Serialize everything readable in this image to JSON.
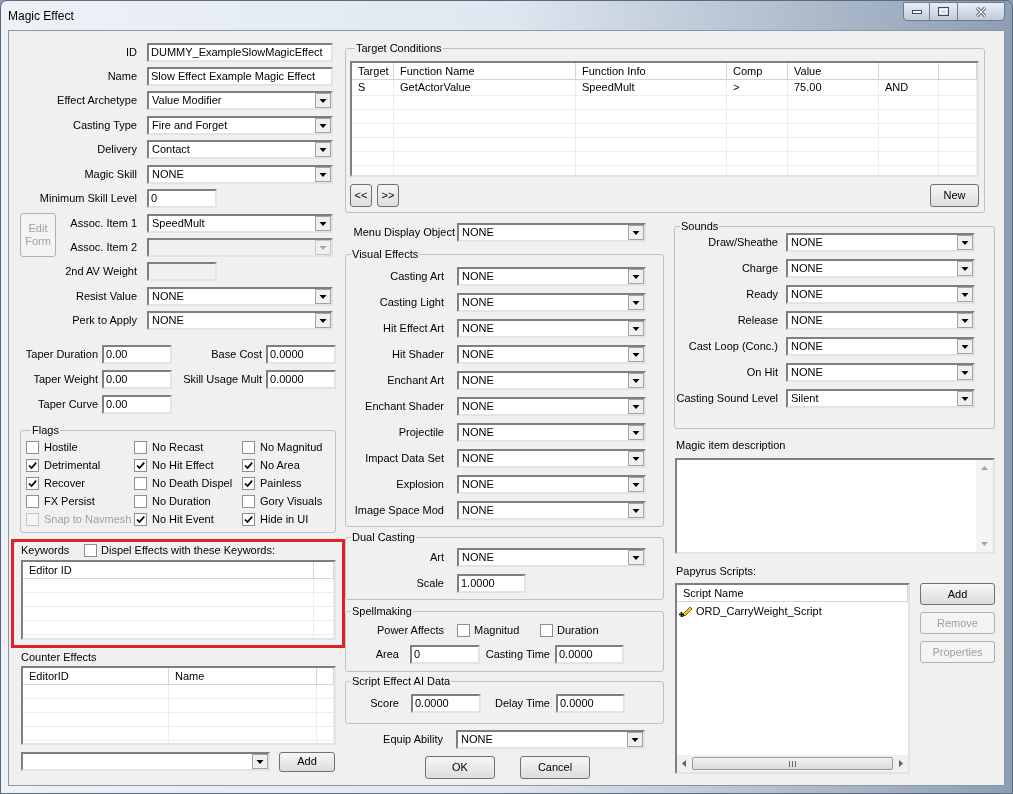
{
  "window": {
    "title": "Magic Effect"
  },
  "general": {
    "fields": [
      {
        "kind": "text",
        "label": "ID",
        "value": "DUMMY_ExampleSlowMagicEffect",
        "disabled": false
      },
      {
        "kind": "text",
        "label": "Name",
        "value": "Slow Effect Example Magic Effect",
        "disabled": false
      },
      {
        "kind": "dropdown",
        "label": "Effect Archetype",
        "value": "Value Modifier",
        "disabled": false
      },
      {
        "kind": "dropdown",
        "label": "Casting Type",
        "value": "Fire and Forget",
        "disabled": false
      },
      {
        "kind": "dropdown",
        "label": "Delivery",
        "value": "Contact",
        "disabled": false
      },
      {
        "kind": "dropdown",
        "label": "Magic Skill",
        "value": "NONE",
        "disabled": false
      },
      {
        "kind": "number",
        "label": "Minimum Skill Level",
        "value": "0",
        "disabled": false
      },
      {
        "kind": "button_group",
        "button": {
          "label": "Edit Form",
          "disabled": true
        },
        "fields": [
          {
            "kind": "dropdown",
            "label": "Assoc. Item 1",
            "value": "SpeedMult",
            "disabled": false
          },
          {
            "kind": "dropdown",
            "label": "Assoc. Item 2",
            "disabled": true
          }
        ]
      },
      {
        "kind": "number",
        "label": "2nd AV Weight",
        "disabled": true
      },
      {
        "kind": "dropdown",
        "label": "Resist Value",
        "value": "NONE",
        "disabled": false
      },
      {
        "kind": "dropdown",
        "label": "Perk to Apply",
        "value": "NONE",
        "disabled": false
      }
    ]
  },
  "taper": [
    {
      "label": "Taper Duration",
      "value": "0.00"
    },
    {
      "label": "Taper Weight",
      "value": "0.00"
    },
    {
      "label": "Taper Curve",
      "value": "0.00"
    }
  ],
  "costs": [
    {
      "label": "Base Cost",
      "value": "0.0000"
    },
    {
      "label": "Skill Usage Mult",
      "value": "0.0000"
    }
  ],
  "flags": {
    "title": "Flags",
    "items": [
      {
        "label": "Hostile",
        "checked": false,
        "disabled": false
      },
      {
        "label": "No Recast",
        "checked": false,
        "disabled": false
      },
      {
        "label": "No Magnitud",
        "checked": false,
        "disabled": false
      },
      {
        "label": "Detrimental",
        "checked": true,
        "disabled": false
      },
      {
        "label": "No Hit Effect",
        "checked": true,
        "disabled": false
      },
      {
        "label": "No Area",
        "checked": true,
        "disabled": false
      },
      {
        "label": "Recover",
        "checked": true,
        "disabled": false
      },
      {
        "label": "No Death Dispel",
        "checked": false,
        "disabled": false
      },
      {
        "label": "Painless",
        "checked": true,
        "disabled": false
      },
      {
        "label": "FX Persist",
        "checked": false,
        "disabled": false
      },
      {
        "label": "No Duration",
        "checked": false,
        "disabled": false
      },
      {
        "label": "Gory Visuals",
        "checked": false,
        "disabled": false
      },
      {
        "label": "Snap to Navmesh",
        "checked": false,
        "disabled": true
      },
      {
        "label": "No Hit Event",
        "checked": true,
        "disabled": false
      },
      {
        "label": "Hide in UI",
        "checked": true,
        "disabled": false
      }
    ]
  },
  "keywords": {
    "title": "Keywords",
    "highlighted": true,
    "dispel": {
      "label": "Dispel Effects with these Keywords:",
      "checked": false
    },
    "columns": [
      "Editor ID"
    ]
  },
  "counter_effects": {
    "title": "Counter Effects",
    "columns": [
      "EditorID",
      "Name"
    ],
    "add_button": "Add"
  },
  "target_conditions": {
    "title": "Target Conditions",
    "columns": [
      "Target",
      "Function Name",
      "Function Info",
      "Comp",
      "Value"
    ],
    "rows": [
      [
        "S",
        "GetActorValue",
        "SpeedMult",
        ">",
        "75.00",
        "AND"
      ]
    ],
    "nav_buttons": [
      "<<",
      ">>"
    ],
    "new_button": "New"
  },
  "menu_display_object": {
    "label": "Menu Display Object",
    "value": "NONE"
  },
  "visual_effects": {
    "title": "Visual Effects",
    "items": [
      {
        "label": "Casting Art",
        "value": "NONE"
      },
      {
        "label": "Casting Light",
        "value": "NONE"
      },
      {
        "label": "Hit Effect Art",
        "value": "NONE"
      },
      {
        "label": "Hit Shader",
        "value": "NONE"
      },
      {
        "label": "Enchant Art",
        "value": "NONE"
      },
      {
        "label": "Enchant Shader",
        "value": "NONE"
      },
      {
        "label": "Projectile",
        "value": "NONE"
      },
      {
        "label": "Impact Data Set",
        "value": "NONE"
      },
      {
        "label": "Explosion",
        "value": "NONE"
      },
      {
        "label": "Image Space Mod",
        "value": "NONE"
      }
    ]
  },
  "dual_casting": {
    "title": "Dual Casting",
    "art": {
      "label": "Art",
      "value": "NONE"
    },
    "scale": {
      "label": "Scale",
      "value": "1.0000"
    }
  },
  "spellmaking": {
    "title": "Spellmaking",
    "power_affects": {
      "label": "Power Affects",
      "options": [
        {
          "label": "Magnitud",
          "checked": false
        },
        {
          "label": "Duration",
          "checked": false
        }
      ]
    },
    "area": {
      "label": "Area",
      "value": "0"
    },
    "casting_time": {
      "label": "Casting Time",
      "value": "0.0000"
    }
  },
  "script_effect_ai": {
    "title": "Script Effect AI Data",
    "score": {
      "label": "Score",
      "value": "0.0000"
    },
    "delay_time": {
      "label": "Delay Time",
      "value": "0.0000"
    }
  },
  "equip_ability": {
    "label": "Equip Ability",
    "value": "NONE"
  },
  "dialog_buttons": [
    "OK",
    "Cancel"
  ],
  "sounds": {
    "title": "Sounds",
    "items": [
      {
        "label": "Draw/Sheathe",
        "value": "NONE"
      },
      {
        "label": "Charge",
        "value": "NONE"
      },
      {
        "label": "Ready",
        "value": "NONE"
      },
      {
        "label": "Release",
        "value": "NONE"
      },
      {
        "label": "Cast Loop (Conc.)",
        "value": "NONE"
      },
      {
        "label": "On Hit",
        "value": "NONE"
      },
      {
        "label": "Casting Sound Level",
        "value": "Silent"
      }
    ]
  },
  "description": {
    "label": "Magic item description"
  },
  "papyrus_scripts": {
    "label": "Papyrus Scripts:",
    "columns": [
      "Script Name"
    ],
    "scripts": [
      "ORD_CarryWeight_Script"
    ],
    "buttons": [
      {
        "label": "Add",
        "disabled": false
      },
      {
        "label": "Remove",
        "disabled": true
      },
      {
        "label": "Properties",
        "disabled": true
      }
    ]
  }
}
